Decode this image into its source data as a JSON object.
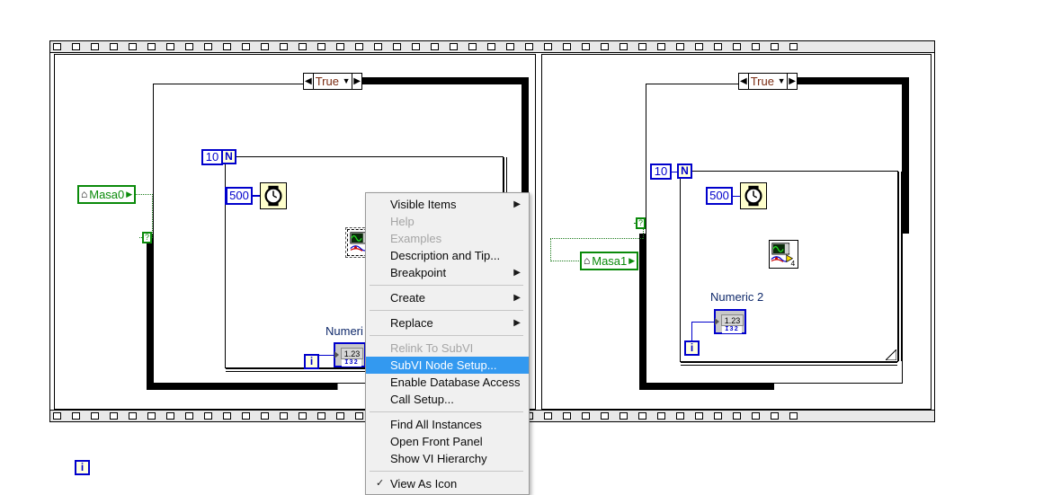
{
  "app": {
    "kind": "labview-block-diagram",
    "background": "#ffffff"
  },
  "colors": {
    "wire_numeric": "#0000cc",
    "wire_boolean": "#1a7a1a",
    "case_label": "#7a2b12",
    "menu_highlight": "#3399f0",
    "menu_background": "#f0f0f0",
    "node_yellow": "#ffffcc",
    "terminal_blue": "#0000cc",
    "ref_green": "#0a8a0a"
  },
  "frames": {
    "left": {
      "case_selector": "True",
      "left_arrow": "◀",
      "right_arrow": "▶",
      "caret": "▼",
      "count_constant": "10",
      "n_terminal": "N",
      "i_terminal": "i",
      "wait_constant": "500",
      "wait_icon": "stopwatch-icon",
      "subvi_icon": "waveform-subvi-icon",
      "indicator_label": "Numeri",
      "indicator_value": "1.23",
      "indicator_type": "I32",
      "control_ref_name": "Masa0",
      "control_ref_glyph": "⌂",
      "control_ref_tri": "▶",
      "selector_terminal": "?"
    },
    "right": {
      "case_selector": "True",
      "left_arrow": "◀",
      "right_arrow": "▶",
      "caret": "▼",
      "count_constant": "10",
      "n_terminal": "N",
      "i_terminal": "i",
      "wait_constant": "500",
      "wait_icon": "stopwatch-icon",
      "subvi_icon": "waveform-subvi-icon",
      "subvi_badge": "4",
      "indicator_label": "Numeric 2",
      "indicator_value": "1.23",
      "indicator_type": "I32",
      "control_ref_name": "Masa1",
      "control_ref_glyph": "⌂",
      "control_ref_tri": "▶",
      "selector_terminal": "?"
    }
  },
  "loose_terminal": {
    "label": "i"
  },
  "context_menu": {
    "items": [
      {
        "label": "Visible Items",
        "submenu": true,
        "disabled": false,
        "highlight": false,
        "checked": false
      },
      {
        "label": "Help",
        "submenu": false,
        "disabled": true,
        "highlight": false,
        "checked": false
      },
      {
        "label": "Examples",
        "submenu": false,
        "disabled": true,
        "highlight": false,
        "checked": false
      },
      {
        "label": "Description and Tip...",
        "submenu": false,
        "disabled": false,
        "highlight": false,
        "checked": false
      },
      {
        "label": "Breakpoint",
        "submenu": true,
        "disabled": false,
        "highlight": false,
        "checked": false
      },
      {
        "separator": true
      },
      {
        "label": "Create",
        "submenu": true,
        "disabled": false,
        "highlight": false,
        "checked": false
      },
      {
        "separator": true
      },
      {
        "label": "Replace",
        "submenu": true,
        "disabled": false,
        "highlight": false,
        "checked": false
      },
      {
        "separator": true
      },
      {
        "label": "Relink To SubVI",
        "submenu": false,
        "disabled": true,
        "highlight": false,
        "checked": false
      },
      {
        "label": "SubVI Node Setup...",
        "submenu": false,
        "disabled": false,
        "highlight": true,
        "checked": false
      },
      {
        "label": "Enable Database Access",
        "submenu": false,
        "disabled": false,
        "highlight": false,
        "checked": false
      },
      {
        "label": "Call Setup...",
        "submenu": false,
        "disabled": false,
        "highlight": false,
        "checked": false
      },
      {
        "separator": true
      },
      {
        "label": "Find All Instances",
        "submenu": false,
        "disabled": false,
        "highlight": false,
        "checked": false
      },
      {
        "label": "Open Front Panel",
        "submenu": false,
        "disabled": false,
        "highlight": false,
        "checked": false
      },
      {
        "label": "Show VI Hierarchy",
        "submenu": false,
        "disabled": false,
        "highlight": false,
        "checked": false
      },
      {
        "separator": true
      },
      {
        "label": "View As Icon",
        "submenu": false,
        "disabled": false,
        "highlight": false,
        "checked": true
      }
    ],
    "submenu_glyph": "▶",
    "check_glyph": "✓"
  }
}
